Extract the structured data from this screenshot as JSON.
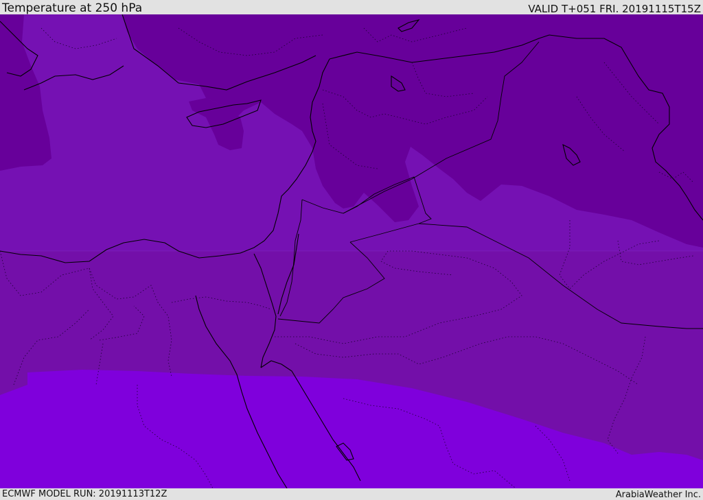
{
  "header": {
    "title": "Temperature at 250 hPa",
    "valid": "VALID T+051 FRI. 20191115T15Z"
  },
  "footer": {
    "model_run": "ECMWF MODEL RUN: 20191113T12Z",
    "credit": "ArabiaWeather Inc."
  },
  "map": {
    "field": "temperature",
    "level": "250 hPa",
    "colors": {
      "coldest": "#67009a",
      "cold": "#7410b0",
      "mid": "#7310a8",
      "warm": "#7f00dc",
      "border": "#000000"
    }
  }
}
